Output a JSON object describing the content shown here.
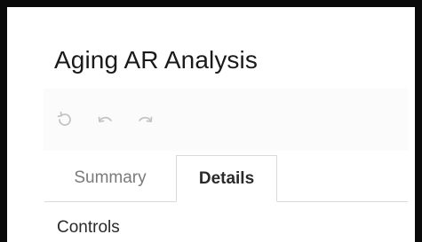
{
  "page": {
    "title": "Aging AR Analysis"
  },
  "toolbar": {
    "icons": [
      "refresh-icon",
      "undo-icon",
      "redo-icon"
    ],
    "icon_color": "#c4c4c4"
  },
  "tabs": [
    {
      "label": "Summary",
      "active": false
    },
    {
      "label": "Details",
      "active": true
    }
  ],
  "section": {
    "heading": "Controls"
  },
  "colors": {
    "frame": "#0a0a0a",
    "text": "#1a1a1a",
    "muted_text": "#7a7a7a",
    "border": "#d9d9d9",
    "toolbar_bg": "#fbfbfb"
  }
}
